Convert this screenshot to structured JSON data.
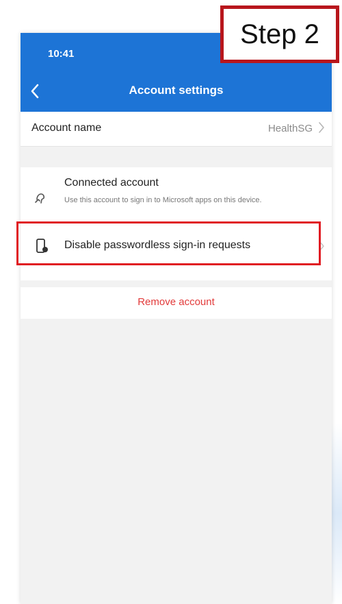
{
  "status_bar": {
    "time": "10:41"
  },
  "header": {
    "title": "Account settings",
    "back_icon": "chevron-left-icon"
  },
  "account_name_row": {
    "label": "Account name",
    "value": "HealthSG"
  },
  "connected_account": {
    "title": "Connected account",
    "description": "Use this account to sign in to Microsoft apps on this device."
  },
  "disable_row": {
    "label": "Disable passwordless sign-in requests"
  },
  "remove_account": {
    "label": "Remove account"
  },
  "step_label": "Step 2",
  "colors": {
    "accent": "#1d74d6",
    "danger": "#e23a3a",
    "highlight_border": "#e01b22",
    "step_border": "#b8161c"
  }
}
